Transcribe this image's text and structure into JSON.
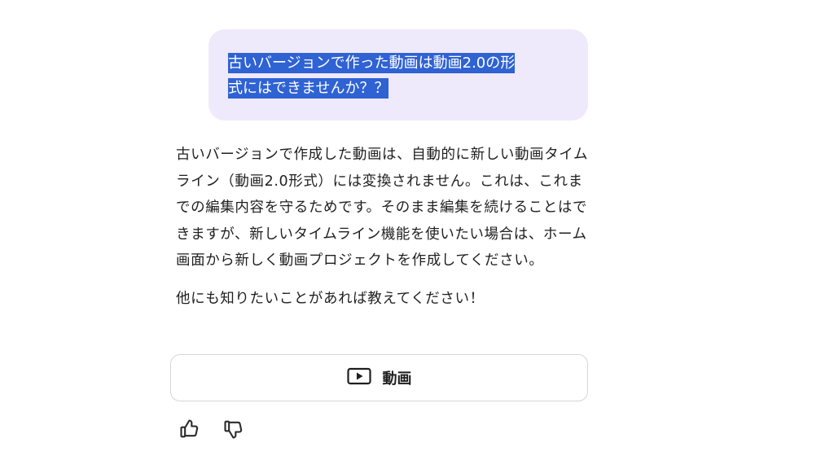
{
  "user_message": {
    "line1": "古いバージョンで作った動画は動画2.0の形",
    "line2": "式にはできませんか？？"
  },
  "assistant_message": {
    "paragraphs": [
      "古いバージョンで作成した動画は、自動的に新しい動画タイムライン（動画2.0形式）には変換されません。これは、これまでの編集内容を守るためです。そのまま編集を続けることはできますが、新しいタイムライン機能を使いたい場合は、ホーム画面から新しく動画プロジェクトを作成してください。",
      "他にも知りたいことがあれば教えてください！"
    ]
  },
  "video_button": {
    "label": "動画",
    "icon": "video-play-icon"
  },
  "feedback": {
    "like_icon": "thumbs-up-icon",
    "dislike_icon": "thumbs-down-icon"
  },
  "colors": {
    "user_bubble_bg": "#efe9fc",
    "selection_highlight": "#2f62d3",
    "text": "#1f1f1f",
    "button_border": "#d6d6dc"
  }
}
